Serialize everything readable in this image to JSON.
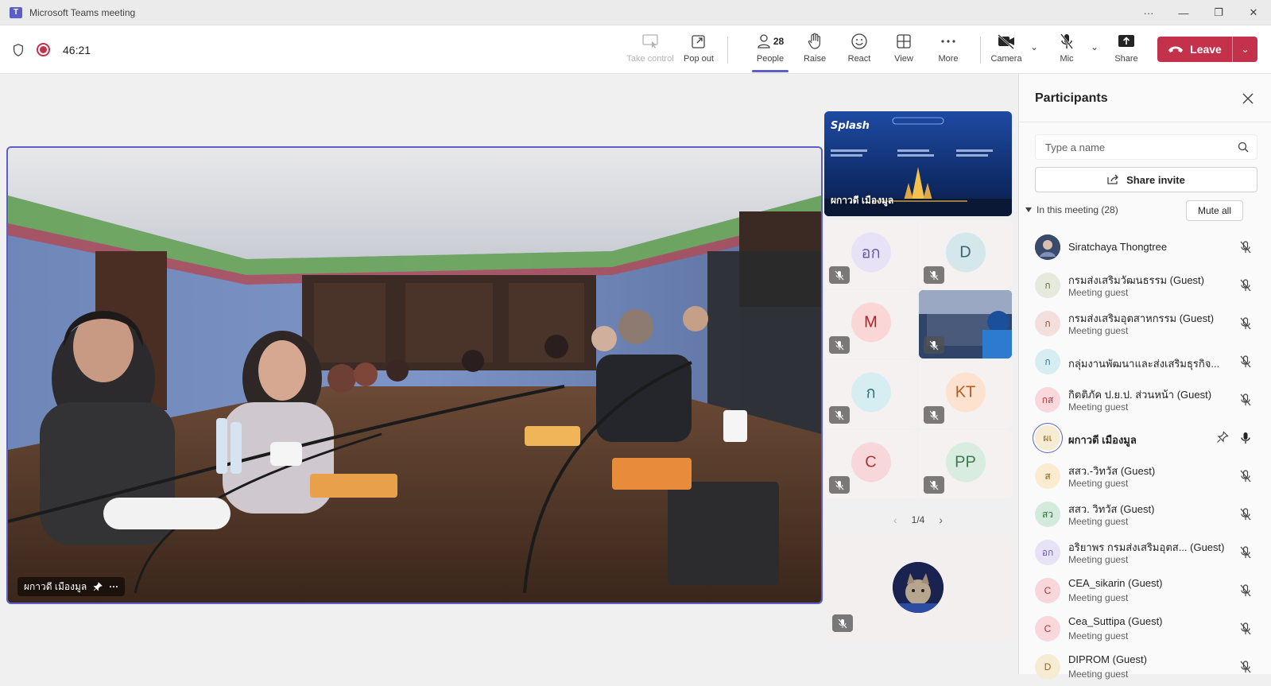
{
  "window": {
    "title": "Microsoft Teams meeting",
    "controls": [
      "more-icon",
      "minimize-icon",
      "maximize-icon",
      "close-icon"
    ]
  },
  "toolbar": {
    "timer": "46:21",
    "take_control": "Take control",
    "pop_out": "Pop out",
    "people_label": "People",
    "people_count": "28",
    "raise": "Raise",
    "react": "React",
    "view": "View",
    "more": "More",
    "camera": "Camera",
    "mic": "Mic",
    "share": "Share",
    "leave": "Leave"
  },
  "stage": {
    "main_name": "ผกาวดี เมืองมูล",
    "share_tile_name": "ผกาวดี เมืองมูล",
    "tiles": [
      {
        "initials": "อก",
        "color": "#e7e2f6",
        "text_color": "#6b5fa3"
      },
      {
        "initials": "D",
        "color": "#d4e8ec",
        "text_color": "#3b6470"
      },
      {
        "initials": "M",
        "color": "#fbd6d6",
        "text_color": "#a4262c"
      },
      {
        "initials": "ก",
        "color": "#d6eef2",
        "text_color": "#2f6f7a"
      },
      {
        "initials": "KT",
        "color": "#fde2cf",
        "text_color": "#b55a20"
      },
      {
        "initials": "C",
        "color": "#f7d7d9",
        "text_color": "#a4373a"
      },
      {
        "initials": "PP",
        "color": "#d8ecdf",
        "text_color": "#3d7a52"
      }
    ],
    "pager": "1/4"
  },
  "panel": {
    "title": "Participants",
    "search_placeholder": "Type a name",
    "share_invite": "Share invite",
    "in_meeting": "In this meeting (28)",
    "mute_all": "Mute all",
    "participants": [
      {
        "name": "Siratchaya Thongtree",
        "sub": "",
        "initials": "",
        "avatar_color": "#3a4a6b",
        "text_color": "#ffffff",
        "muted": true
      },
      {
        "name": "กรมส่งเสริมวัฒนธรรม (Guest)",
        "sub": "Meeting guest",
        "initials": "ก",
        "avatar_color": "#e5eadc",
        "text_color": "#5a6e3a",
        "muted": true
      },
      {
        "name": "กรมส่งเสริมอุตสาหกรรม (Guest)",
        "sub": "Meeting guest",
        "initials": "ก",
        "avatar_color": "#f3e0dc",
        "text_color": "#8a4a3c",
        "muted": true
      },
      {
        "name": "กลุ่มงานพัฒนาและส่งเสริมธุรกิจ...",
        "sub": "",
        "initials": "ก",
        "avatar_color": "#d6eef2",
        "text_color": "#2f6f7a",
        "muted": true
      },
      {
        "name": "กิตติภัค ป.ย.ป. ส่วนหน้า (Guest)",
        "sub": "Meeting guest",
        "initials": "กส",
        "avatar_color": "#f9d8dc",
        "text_color": "#a4373a",
        "muted": true
      },
      {
        "name": "ผกาวดี เมืองมูล",
        "sub": "",
        "initials": "ผเ",
        "avatar_color": "#f6ecd4",
        "text_color": "#8a6a1a",
        "muted": false,
        "pinned": true,
        "speaking": true
      },
      {
        "name": "สสว.-วิทวัส (Guest)",
        "sub": "Meeting guest",
        "initials": "ส",
        "avatar_color": "#fbebd0",
        "text_color": "#8a5a10",
        "muted": true
      },
      {
        "name": "สสว. วิทวัส (Guest)",
        "sub": "Meeting guest",
        "initials": "สว",
        "avatar_color": "#d4eadb",
        "text_color": "#2f6e44",
        "muted": true
      },
      {
        "name": "อริยาพร กรมส่งเสริมอุตส... (Guest)",
        "sub": "Meeting guest",
        "initials": "อก",
        "avatar_color": "#e7e2f6",
        "text_color": "#6b5fa3",
        "muted": true
      },
      {
        "name": "CEA_sikarin (Guest)",
        "sub": "Meeting guest",
        "initials": "C",
        "avatar_color": "#f7d7d9",
        "text_color": "#a4373a",
        "muted": true
      },
      {
        "name": "Cea_Suttipa (Guest)",
        "sub": "Meeting guest",
        "initials": "C",
        "avatar_color": "#f9d8dc",
        "text_color": "#a4373a",
        "muted": true
      },
      {
        "name": "DIPROM (Guest)",
        "sub": "Meeting guest",
        "initials": "D",
        "avatar_color": "#f6ecd4",
        "text_color": "#8a6a1a",
        "muted": true
      }
    ]
  },
  "colors": {
    "accent": "#5b5fc7",
    "leave": "#c4314b"
  }
}
